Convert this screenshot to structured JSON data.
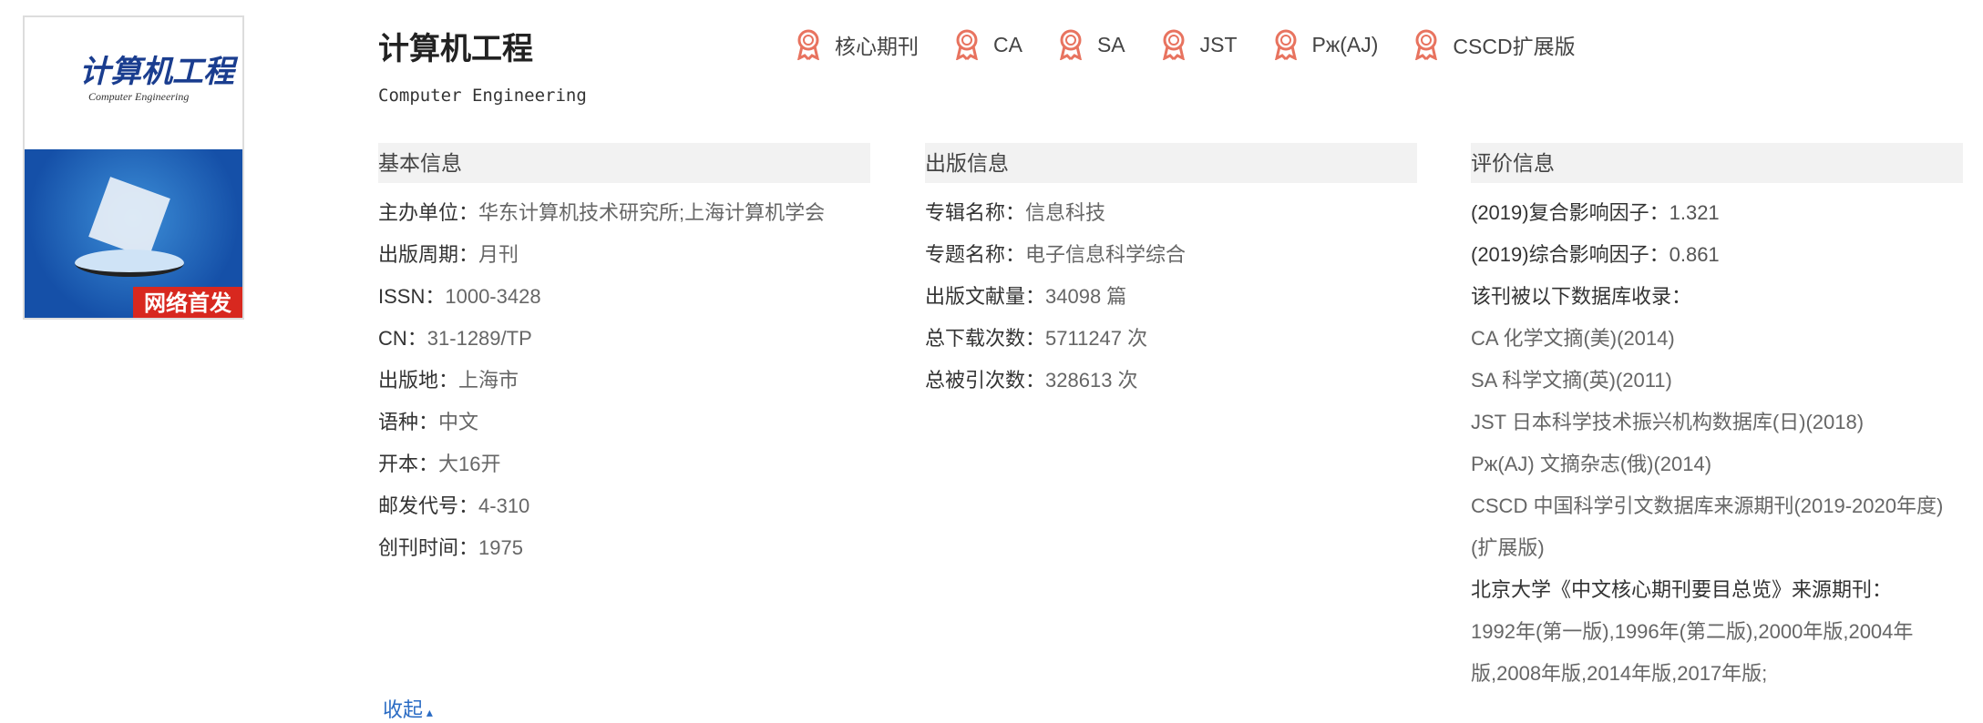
{
  "cover": {
    "badge": "网络首发",
    "title": "计算机工程",
    "subtitle": "Computer Engineering"
  },
  "header": {
    "title": "计算机工程",
    "subtitle": "Computer Engineering"
  },
  "tags": [
    "核心期刊",
    "CA",
    "SA",
    "JST",
    "Pж(AJ)",
    "CSCD扩展版"
  ],
  "accent": "#e8735f",
  "basic": {
    "heading": "基本信息",
    "rows": [
      {
        "label": "主办单位：",
        "value": "华东计算机技术研究所;上海计算机学会"
      },
      {
        "label": "出版周期：",
        "value": "月刊"
      },
      {
        "label": "ISSN：",
        "value": "1000-3428"
      },
      {
        "label": "CN：",
        "value": "31-1289/TP"
      },
      {
        "label": "出版地：",
        "value": "上海市"
      },
      {
        "label": "语种：",
        "value": "中文"
      },
      {
        "label": "开本：",
        "value": "大16开"
      },
      {
        "label": "邮发代号：",
        "value": "4-310"
      },
      {
        "label": "创刊时间：",
        "value": "1975"
      }
    ]
  },
  "publish": {
    "heading": "出版信息",
    "rows": [
      {
        "label": "专辑名称：",
        "value": "信息科技"
      },
      {
        "label": "专题名称：",
        "value": "电子信息科学综合"
      },
      {
        "label": "出版文献量：",
        "value": "34098 篇"
      },
      {
        "label": "总下载次数：",
        "value": "5711247 次"
      },
      {
        "label": "总被引次数：",
        "value": "328613 次"
      }
    ]
  },
  "evaluation": {
    "heading": "评价信息",
    "rows": [
      {
        "label": "(2019)复合影响因子：",
        "value": "1.321"
      },
      {
        "label": "(2019)综合影响因子：",
        "value": "0.861"
      }
    ],
    "db_label": "该刊被以下数据库收录：",
    "databases": [
      "CA 化学文摘(美)(2014)",
      "SA 科学文摘(英)(2011)",
      "JST 日本科学技术振兴机构数据库(日)(2018)",
      "Pж(AJ) 文摘杂志(俄)(2014)",
      "CSCD 中国科学引文数据库来源期刊(2019-2020年度)(扩展版)"
    ],
    "pku_label": "北京大学《中文核心期刊要目总览》来源期刊：",
    "pku_value": "1992年(第一版),1996年(第二版),2000年版,2004年版,2008年版,2014年版,2017年版;"
  },
  "collapse_label": "收起"
}
